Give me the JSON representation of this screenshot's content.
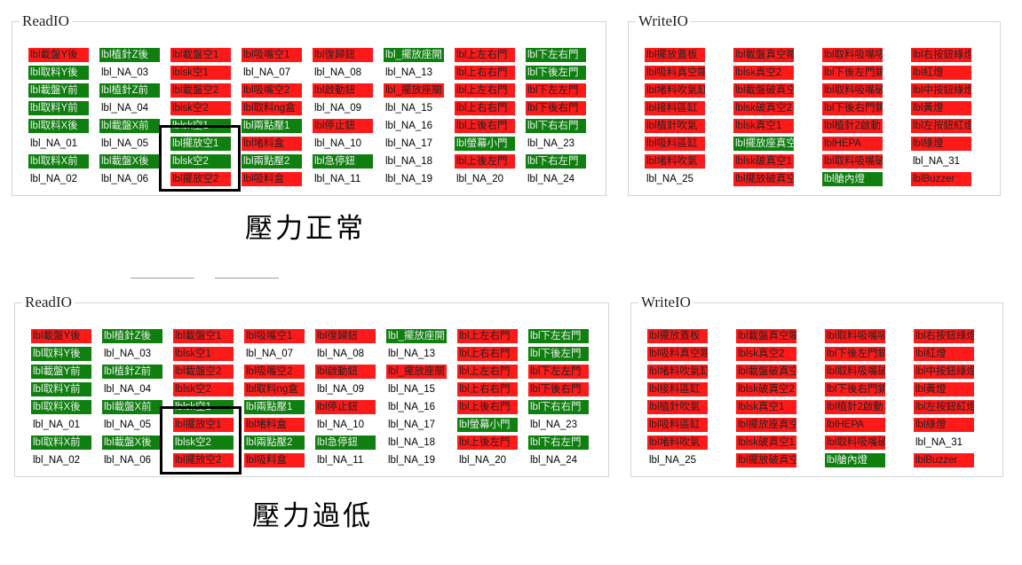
{
  "panels": [
    {
      "caption": "壓力正常",
      "read": {
        "legend": "ReadIO",
        "columns": [
          [
            [
              "lbl載盤Y後",
              "r"
            ],
            [
              "lbl取料Y後",
              "g"
            ],
            [
              "lbl載盤Y前",
              "g"
            ],
            [
              "lbl取料Y前",
              "g"
            ],
            [
              "lbl取料X後",
              "g"
            ],
            [
              "lbl_NA_01",
              "w"
            ],
            [
              "lbl取料X前",
              "g"
            ],
            [
              "lbl_NA_02",
              "w"
            ]
          ],
          [
            [
              "lbl植針Z後",
              "g"
            ],
            [
              "lbl_NA_03",
              "w"
            ],
            [
              "lbl植針Z前",
              "g"
            ],
            [
              "lbl_NA_04",
              "w"
            ],
            [
              "lbl載盤X前",
              "g"
            ],
            [
              "lbl_NA_05",
              "w"
            ],
            [
              "lbl載盤X後",
              "g"
            ],
            [
              "lbl_NA_06",
              "w"
            ]
          ],
          [
            [
              "lbl載盤空1",
              "r"
            ],
            [
              "lblsk空1",
              "r"
            ],
            [
              "lbl載盤空2",
              "r"
            ],
            [
              "lblsk空2",
              "r"
            ],
            [
              "lblsk空1",
              "g"
            ],
            [
              "lbl擺放空1",
              "g"
            ],
            [
              "lblsk空2",
              "g"
            ],
            [
              "lbl擺放空2",
              "r"
            ]
          ],
          [
            [
              "lbl吸嘴空1",
              "r"
            ],
            [
              "lbl_NA_07",
              "w"
            ],
            [
              "lbl吸嘴空2",
              "r"
            ],
            [
              "lbl取料ng盒",
              "r"
            ],
            [
              "lbl兩點壓1",
              "g"
            ],
            [
              "lbl堵料盒",
              "r"
            ],
            [
              "lbl兩點壓2",
              "g"
            ],
            [
              "lbl吸料盒",
              "r"
            ]
          ],
          [
            [
              "lbl復歸鈕",
              "r"
            ],
            [
              "lbl_NA_08",
              "w"
            ],
            [
              "lbl啟動鈕",
              "r"
            ],
            [
              "lbl_NA_09",
              "w"
            ],
            [
              "lbl停止鈕",
              "r"
            ],
            [
              "lbl_NA_10",
              "w"
            ],
            [
              "lbl急停鈕",
              "g"
            ],
            [
              "lbl_NA_11",
              "w"
            ]
          ],
          [
            [
              "lbl_擺放座開",
              "g"
            ],
            [
              "lbl_NA_13",
              "w"
            ],
            [
              "lbl_擺放座關",
              "r"
            ],
            [
              "lbl_NA_15",
              "w"
            ],
            [
              "lbl_NA_16",
              "w"
            ],
            [
              "lbl_NA_17",
              "w"
            ],
            [
              "lbl_NA_18",
              "w"
            ],
            [
              "lbl_NA_19",
              "w"
            ]
          ],
          [
            [
              "lbl上左右門",
              "r"
            ],
            [
              "lbl上右右門",
              "r"
            ],
            [
              "lbl上左右門",
              "r"
            ],
            [
              "lbl上右右門",
              "r"
            ],
            [
              "lbl上後右門",
              "r"
            ],
            [
              "lbl螢幕小門",
              "g"
            ],
            [
              "lbl上後左門",
              "r"
            ],
            [
              "lbl_NA_20",
              "w"
            ]
          ],
          [
            [
              "lbl下左右門",
              "g"
            ],
            [
              "lbl下後左門",
              "g"
            ],
            [
              "lbl下左左門",
              "r"
            ],
            [
              "lbl下後右門",
              "r"
            ],
            [
              "lbl下右右門",
              "g"
            ],
            [
              "lbl_NA_23",
              "w"
            ],
            [
              "lbl下右左門",
              "g"
            ],
            [
              "lbl_NA_24",
              "w"
            ]
          ]
        ]
      },
      "write": {
        "legend": "WriteIO",
        "columns": [
          [
            [
              "lbl擺放蓋板",
              "r"
            ],
            [
              "lbl吸料真空閥",
              "r"
            ],
            [
              "lbl堵料吹氣缸",
              "r"
            ],
            [
              "lbl接料區缸",
              "r"
            ],
            [
              "lbl植針吹氣",
              "r"
            ],
            [
              "lbl吸料區缸",
              "r"
            ],
            [
              "lbl堵料吹氣",
              "r"
            ],
            [
              "lbl_NA_25",
              "w"
            ]
          ],
          [
            [
              "lbl載盤真空閥",
              "r"
            ],
            [
              "lblsk真空2",
              "r"
            ],
            [
              "lbl載盤破真空",
              "r"
            ],
            [
              "lblsk破真空2",
              "r"
            ],
            [
              "lblsk真空1",
              "r"
            ],
            [
              "lbl擺放座真空",
              "g"
            ],
            [
              "lblsk破真空1",
              "r"
            ],
            [
              "lbl擺放破真空",
              "r"
            ]
          ],
          [
            [
              "lbl取料吸嘴吸",
              "r"
            ],
            [
              "lbl下後左門鎖",
              "r"
            ],
            [
              "lbl取料吸嘴破舊",
              "r"
            ],
            [
              "lbl下後右門鎖",
              "r"
            ],
            [
              "lbl植針2啟動",
              "r"
            ],
            [
              "lblHEPA",
              "r"
            ],
            [
              "lbl取料吸嘴破新",
              "r"
            ],
            [
              "lbl艙內燈",
              "g"
            ]
          ],
          [
            [
              "lbl右按鈕綠燈",
              "r"
            ],
            [
              "lbl紅燈",
              "r"
            ],
            [
              "lbl中按鈕綠燈",
              "r"
            ],
            [
              "lbl黃燈",
              "r"
            ],
            [
              "lbl左按鈕紅燈",
              "r"
            ],
            [
              "lbl綠燈",
              "r"
            ],
            [
              "lbl_NA_31",
              "w"
            ],
            [
              "lblBuzzer",
              "r"
            ]
          ]
        ]
      }
    },
    {
      "caption": "壓力過低",
      "read": {
        "legend": "ReadIO",
        "columns": [
          [
            [
              "lbl載盤Y後",
              "r"
            ],
            [
              "lbl取料Y後",
              "g"
            ],
            [
              "lbl載盤Y前",
              "g"
            ],
            [
              "lbl取料Y前",
              "g"
            ],
            [
              "lbl取料X後",
              "g"
            ],
            [
              "lbl_NA_01",
              "w"
            ],
            [
              "lbl取料X前",
              "g"
            ],
            [
              "lbl_NA_02",
              "w"
            ]
          ],
          [
            [
              "lbl植針Z後",
              "g"
            ],
            [
              "lbl_NA_03",
              "w"
            ],
            [
              "lbl植針Z前",
              "g"
            ],
            [
              "lbl_NA_04",
              "w"
            ],
            [
              "lbl載盤X前",
              "g"
            ],
            [
              "lbl_NA_05",
              "w"
            ],
            [
              "lbl載盤X後",
              "g"
            ],
            [
              "lbl_NA_06",
              "w"
            ]
          ],
          [
            [
              "lbl載盤空1",
              "r"
            ],
            [
              "lblsk空1",
              "r"
            ],
            [
              "lbl載盤空2",
              "r"
            ],
            [
              "lblsk空2",
              "r"
            ],
            [
              "lblsk空1",
              "g"
            ],
            [
              "lbl擺放空1",
              "r"
            ],
            [
              "lblsk空2",
              "g"
            ],
            [
              "lbl擺放空2",
              "r"
            ]
          ],
          [
            [
              "lbl吸嘴空1",
              "r"
            ],
            [
              "lbl_NA_07",
              "w"
            ],
            [
              "lbl吸嘴空2",
              "r"
            ],
            [
              "lbl取料ng盒",
              "r"
            ],
            [
              "lbl兩點壓1",
              "g"
            ],
            [
              "lbl堵料盒",
              "r"
            ],
            [
              "lbl兩點壓2",
              "g"
            ],
            [
              "lbl吸料盒",
              "r"
            ]
          ],
          [
            [
              "lbl復歸鈕",
              "r"
            ],
            [
              "lbl_NA_08",
              "w"
            ],
            [
              "lbl啟動鈕",
              "r"
            ],
            [
              "lbl_NA_09",
              "w"
            ],
            [
              "lbl停止鈕",
              "r"
            ],
            [
              "lbl_NA_10",
              "w"
            ],
            [
              "lbl急停鈕",
              "g"
            ],
            [
              "lbl_NA_11",
              "w"
            ]
          ],
          [
            [
              "lbl_擺放座開",
              "g"
            ],
            [
              "lbl_NA_13",
              "w"
            ],
            [
              "lbl_擺放座關",
              "r"
            ],
            [
              "lbl_NA_15",
              "w"
            ],
            [
              "lbl_NA_16",
              "w"
            ],
            [
              "lbl_NA_17",
              "w"
            ],
            [
              "lbl_NA_18",
              "w"
            ],
            [
              "lbl_NA_19",
              "w"
            ]
          ],
          [
            [
              "lbl上左右門",
              "r"
            ],
            [
              "lbl上右右門",
              "r"
            ],
            [
              "lbl上左右門",
              "r"
            ],
            [
              "lbl上右右門",
              "r"
            ],
            [
              "lbl上後右門",
              "r"
            ],
            [
              "lbl螢幕小門",
              "g"
            ],
            [
              "lbl上後左門",
              "r"
            ],
            [
              "lbl_NA_20",
              "w"
            ]
          ],
          [
            [
              "lbl下左右門",
              "g"
            ],
            [
              "lbl下後左門",
              "g"
            ],
            [
              "lbl下左左門",
              "r"
            ],
            [
              "lbl下後右門",
              "r"
            ],
            [
              "lbl下右右門",
              "g"
            ],
            [
              "lbl_NA_23",
              "w"
            ],
            [
              "lbl下右左門",
              "g"
            ],
            [
              "lbl_NA_24",
              "w"
            ]
          ]
        ]
      },
      "write": {
        "legend": "WriteIO",
        "columns": [
          [
            [
              "lbl擺放蓋板",
              "r"
            ],
            [
              "lbl吸料真空閥",
              "r"
            ],
            [
              "lbl堵料吹氣缸",
              "r"
            ],
            [
              "lbl接料區缸",
              "r"
            ],
            [
              "lbl植針吹氣",
              "r"
            ],
            [
              "lbl吸料區缸",
              "r"
            ],
            [
              "lbl堵料吹氣",
              "r"
            ],
            [
              "lbl_NA_25",
              "w"
            ]
          ],
          [
            [
              "lbl載盤真空閥",
              "r"
            ],
            [
              "lblsk真空2",
              "r"
            ],
            [
              "lbl載盤破真空",
              "r"
            ],
            [
              "lblsk破真空2",
              "r"
            ],
            [
              "lblsk真空1",
              "r"
            ],
            [
              "lbl擺放座真空",
              "r"
            ],
            [
              "lblsk破真空1",
              "r"
            ],
            [
              "lbl擺放破真空",
              "r"
            ]
          ],
          [
            [
              "lbl取料吸嘴吸",
              "r"
            ],
            [
              "lbl下後左門鎖",
              "r"
            ],
            [
              "lbl取料吸嘴破舊",
              "r"
            ],
            [
              "lbl下後右門鎖",
              "r"
            ],
            [
              "lbl植針2啟動",
              "r"
            ],
            [
              "lblHEPA",
              "r"
            ],
            [
              "lbl取料吸嘴破新",
              "r"
            ],
            [
              "lbl艙內燈",
              "g"
            ]
          ],
          [
            [
              "lbl右按鈕綠燈",
              "r"
            ],
            [
              "lbl紅燈",
              "r"
            ],
            [
              "lbl中按鈕綠燈",
              "r"
            ],
            [
              "lbl黃燈",
              "r"
            ],
            [
              "lbl左按鈕紅燈",
              "r"
            ],
            [
              "lbl綠燈",
              "r"
            ],
            [
              "lbl_NA_31",
              "w"
            ],
            [
              "lblBuzzer",
              "r"
            ]
          ]
        ]
      }
    }
  ],
  "colors": {
    "on_red": "#ff1a1a",
    "on_green": "#0f7f0f",
    "border": "#d4d4d4"
  }
}
